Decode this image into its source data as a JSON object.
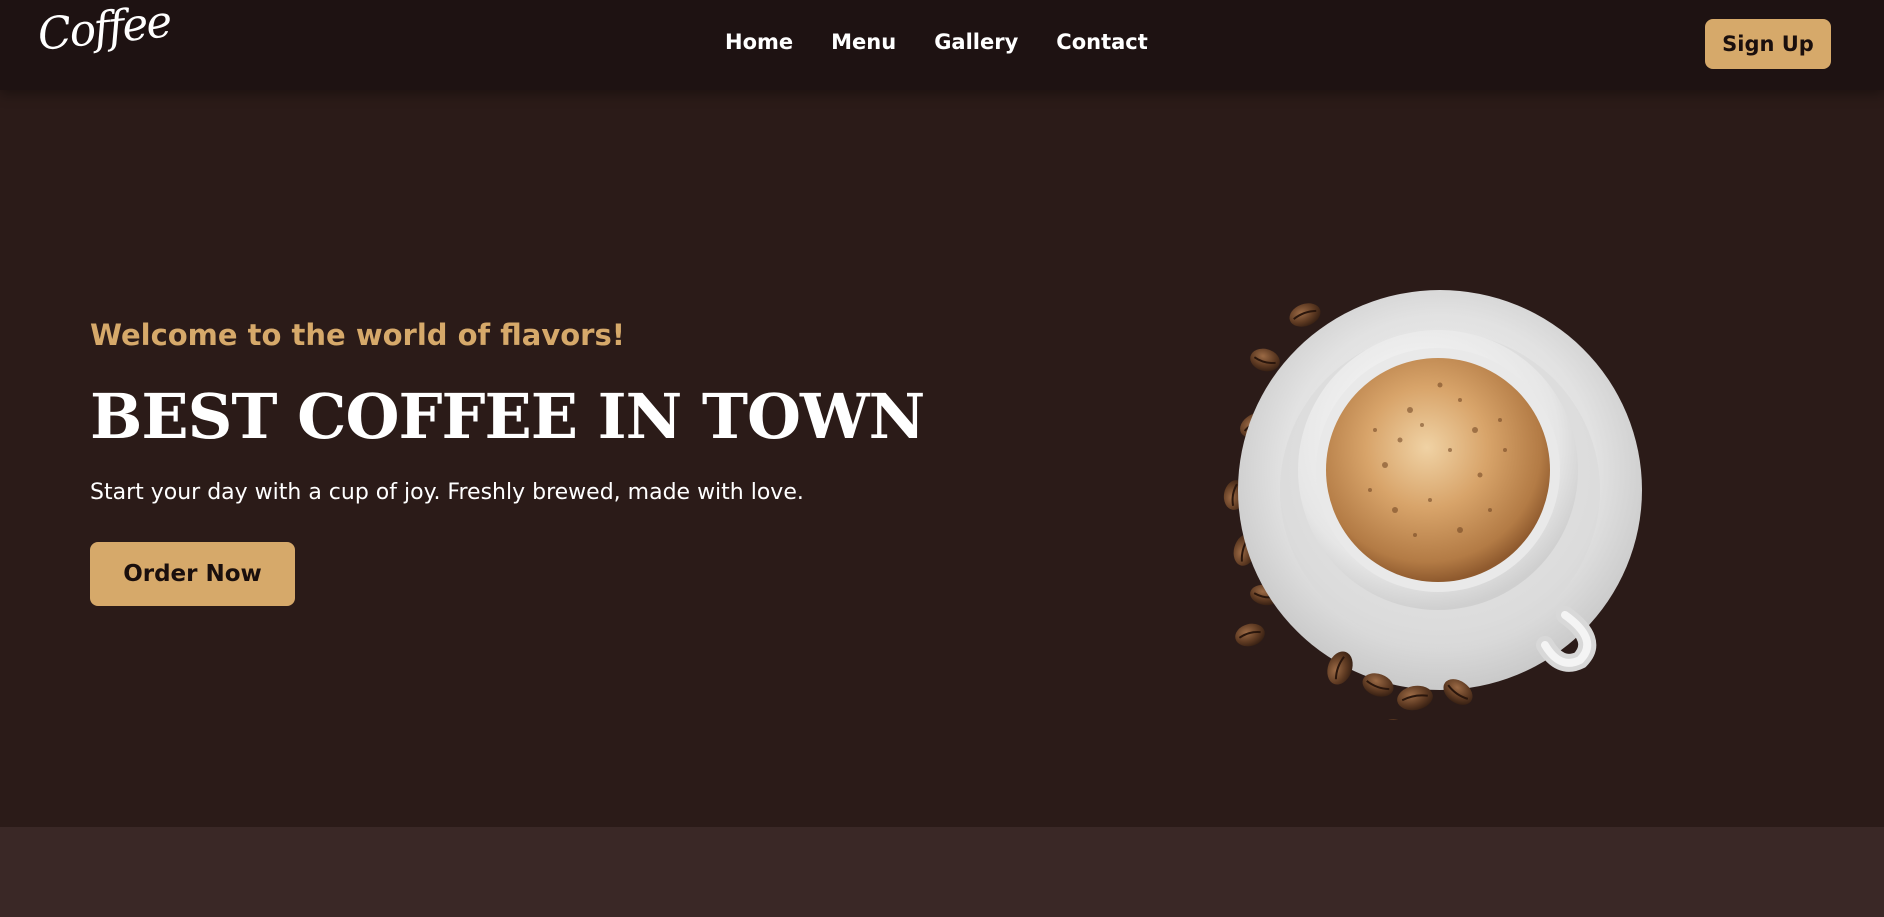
{
  "header": {
    "logo_text": "Coffee",
    "nav": [
      {
        "label": "Home"
      },
      {
        "label": "Menu"
      },
      {
        "label": "Gallery"
      },
      {
        "label": "Contact"
      }
    ],
    "signup_label": "Sign Up"
  },
  "hero": {
    "tagline": "Welcome to the world of flavors!",
    "title": "BEST COFFEE IN TOWN",
    "description": "Start your day with a cup of joy. Freshly brewed, made with love.",
    "cta_label": "Order Now",
    "image_name": "coffee-cup-with-beans-image"
  },
  "colors": {
    "nav_background": "#1e1212",
    "hero_background": "#2b1b18",
    "accent": "#d6a96a",
    "bottom_band": "#3a2826",
    "text": "#ffffff"
  }
}
